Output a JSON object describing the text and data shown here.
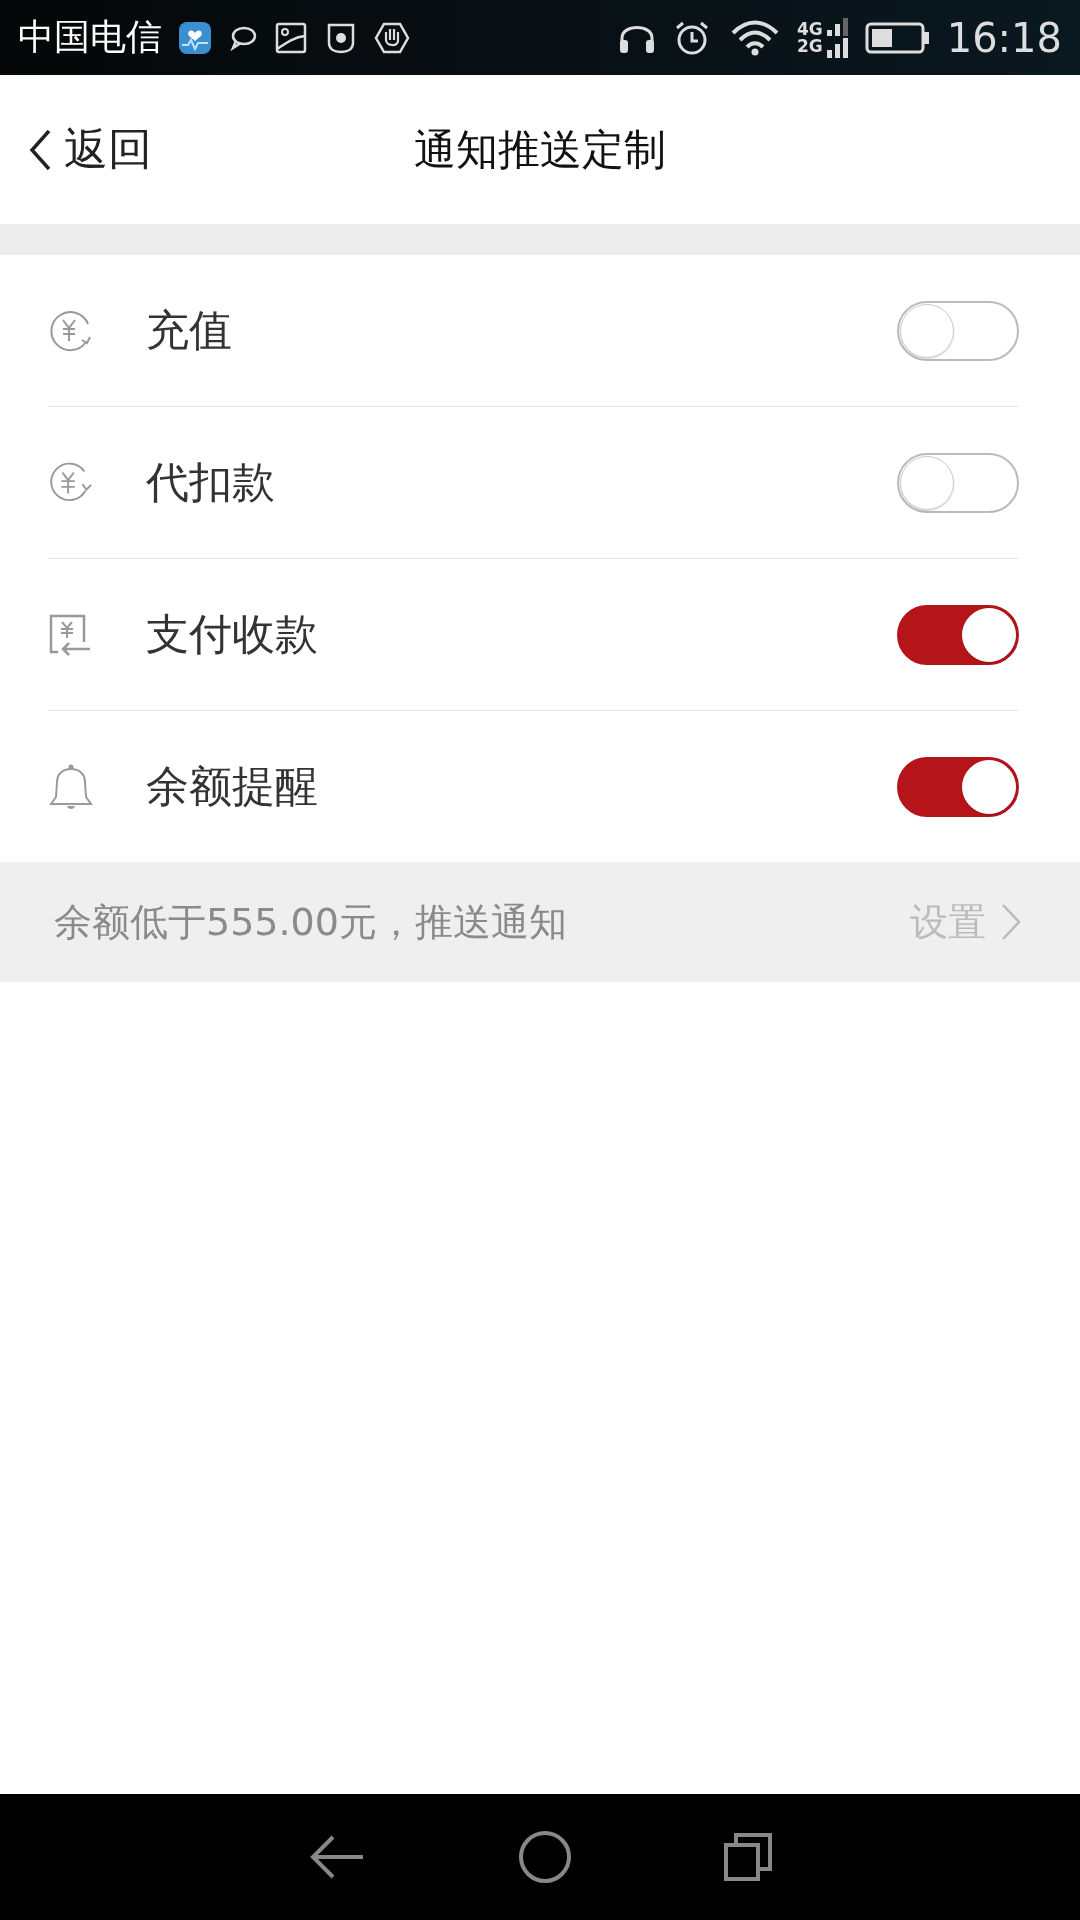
{
  "status_bar": {
    "carrier": "中国电信",
    "network_top": "4G",
    "network_bottom": "2G",
    "time": "16:18"
  },
  "header": {
    "back": "返回",
    "title": "通知推送定制"
  },
  "settings": [
    {
      "label": "充值",
      "on": false
    },
    {
      "label": "代扣款",
      "on": false
    },
    {
      "label": "支付收款",
      "on": true
    },
    {
      "label": "余额提醒",
      "on": true
    }
  ],
  "balance_notice": {
    "text": "余额低于555.00元，推送通知",
    "action": "设置"
  }
}
